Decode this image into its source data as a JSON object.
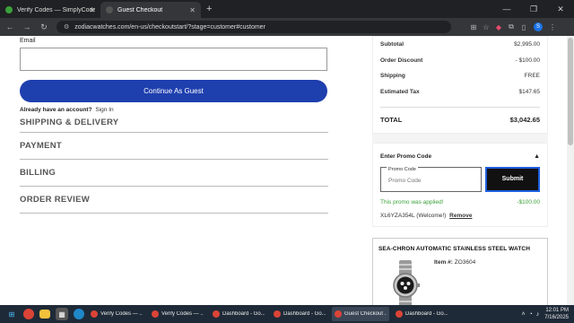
{
  "browser": {
    "tabs": [
      {
        "title": "Verify Codes — SimplyCodes",
        "active": false,
        "color": "#3aa13a"
      },
      {
        "title": "Guest Checkout",
        "active": true,
        "color": "#888888"
      }
    ],
    "url": "zodiacwatches.com/en-us/checkoutstart/?stage=customer#customer",
    "new_tab": "+",
    "profile_initial": "S"
  },
  "checkout": {
    "email_label": "Email",
    "continue_button": "Continue As Guest",
    "account_prompt": "Already have an account?",
    "sign_in": "Sign In",
    "sections": [
      "SHIPPING & DELIVERY",
      "PAYMENT",
      "BILLING",
      "ORDER REVIEW"
    ]
  },
  "summary": {
    "rows": [
      {
        "label": "Subtotal",
        "value": "$2,995.00"
      },
      {
        "label": "Order Discount",
        "value": "- $100.00"
      },
      {
        "label": "Shipping",
        "value": "FREE"
      },
      {
        "label": "Estimated Tax",
        "value": "$147.65"
      }
    ],
    "total_label": "TOTAL",
    "total_value": "$3,042.65"
  },
  "promo": {
    "heading": "Enter Promo Code",
    "field_label": "Promo Code",
    "placeholder": "Promo Code",
    "submit": "Submit",
    "applied_text": "This promo was applied!",
    "applied_value": "-$100.00",
    "code_text": "XL6YZA354L (Welcome!)",
    "remove": "Remove"
  },
  "product": {
    "name": "SEA-CHRON AUTOMATIC STAINLESS STEEL WATCH",
    "item_label": "Item #:",
    "item_number": "ZO3604"
  },
  "taskbar": {
    "apps": [
      {
        "title": "Verify Codes — ...",
        "active": false
      },
      {
        "title": "Verify Codes — ...",
        "active": false
      },
      {
        "title": "Dashboard - Go...",
        "active": false
      },
      {
        "title": "Dashboard - Go...",
        "active": false
      },
      {
        "title": "Guest Checkout ...",
        "active": true
      },
      {
        "title": "Dashboard - Go...",
        "active": false
      }
    ],
    "time": "12:01 PM",
    "date": "7/16/2025"
  },
  "colors": {
    "primary_button": "#1e3fae",
    "promo_success": "#3aa13a",
    "submit_border": "#1e5fe0"
  }
}
